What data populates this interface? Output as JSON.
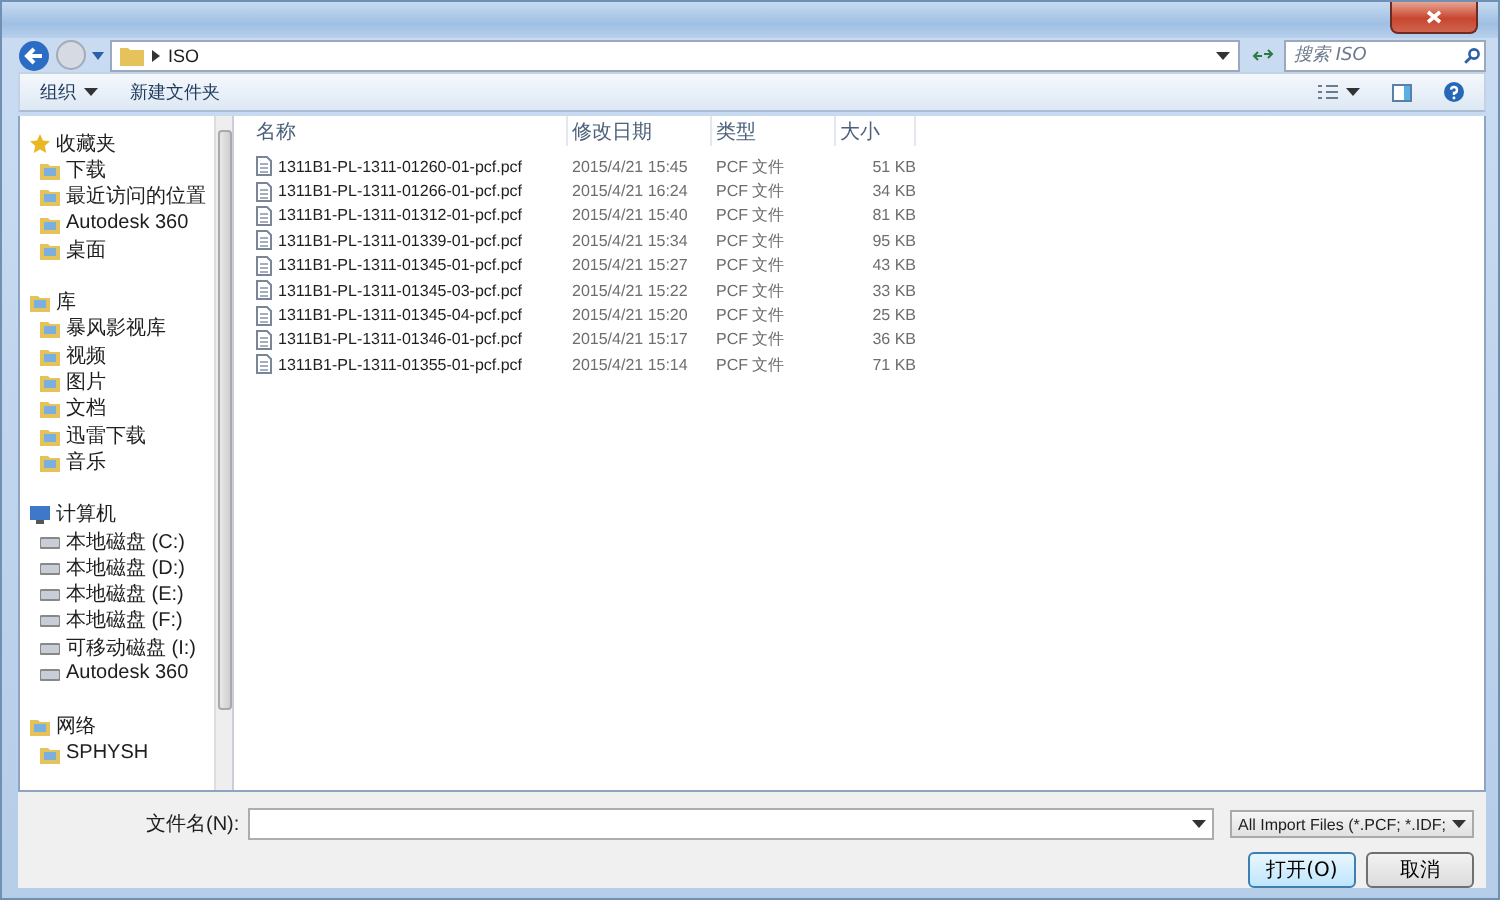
{
  "address": {
    "path": "ISO"
  },
  "search": {
    "placeholder": "搜索 ISO"
  },
  "toolbar": {
    "buttons": [
      {
        "label": "组织",
        "dropdown": true
      },
      {
        "label": "新建文件夹",
        "dropdown": false
      }
    ]
  },
  "sidebar": {
    "groups": [
      {
        "label": "收藏夹",
        "children": [
          {
            "label": "下载"
          },
          {
            "label": "最近访问的位置"
          },
          {
            "label": "Autodesk 360"
          },
          {
            "label": "桌面"
          }
        ]
      },
      {
        "label": "库",
        "children": [
          {
            "label": "暴风影视库"
          },
          {
            "label": "视频"
          },
          {
            "label": "图片"
          },
          {
            "label": "文档"
          },
          {
            "label": "迅雷下载"
          },
          {
            "label": "音乐"
          }
        ]
      },
      {
        "label": "计算机",
        "children": [
          {
            "label": "本地磁盘 (C:)"
          },
          {
            "label": "本地磁盘 (D:)"
          },
          {
            "label": "本地磁盘 (E:)"
          },
          {
            "label": "本地磁盘 (F:)"
          },
          {
            "label": "可移动磁盘 (I:)"
          },
          {
            "label": "Autodesk 360"
          }
        ]
      },
      {
        "label": "网络",
        "children": [
          {
            "label": "SPHYSH"
          }
        ]
      }
    ]
  },
  "file_list": {
    "columns": [
      "名称",
      "修改日期",
      "类型",
      "大小"
    ],
    "rows": [
      {
        "name": "1311B1-PL-1311-01260-01-pcf.pcf",
        "modified": "2015/4/21 15:45",
        "type": "PCF 文件",
        "size": "51 KB"
      },
      {
        "name": "1311B1-PL-1311-01266-01-pcf.pcf",
        "modified": "2015/4/21 16:24",
        "type": "PCF 文件",
        "size": "34 KB"
      },
      {
        "name": "1311B1-PL-1311-01312-01-pcf.pcf",
        "modified": "2015/4/21 15:40",
        "type": "PCF 文件",
        "size": "81 KB"
      },
      {
        "name": "1311B1-PL-1311-01339-01-pcf.pcf",
        "modified": "2015/4/21 15:34",
        "type": "PCF 文件",
        "size": "95 KB"
      },
      {
        "name": "1311B1-PL-1311-01345-01-pcf.pcf",
        "modified": "2015/4/21 15:27",
        "type": "PCF 文件",
        "size": "43 KB"
      },
      {
        "name": "1311B1-PL-1311-01345-03-pcf.pcf",
        "modified": "2015/4/21 15:22",
        "type": "PCF 文件",
        "size": "33 KB"
      },
      {
        "name": "1311B1-PL-1311-01345-04-pcf.pcf",
        "modified": "2015/4/21 15:20",
        "type": "PCF 文件",
        "size": "25 KB"
      },
      {
        "name": "1311B1-PL-1311-01346-01-pcf.pcf",
        "modified": "2015/4/21 15:17",
        "type": "PCF 文件",
        "size": "36 KB"
      },
      {
        "name": "1311B1-PL-1311-01355-01-pcf.pcf",
        "modified": "2015/4/21 15:14",
        "type": "PCF 文件",
        "size": "71 KB"
      }
    ]
  },
  "footer": {
    "filename_label": "文件名(N):",
    "file_type": "All Import Files (*.PCF; *.IDF;",
    "buttons": [
      {
        "label": "打开(O)",
        "default": true
      },
      {
        "label": "取消",
        "default": false
      }
    ]
  }
}
